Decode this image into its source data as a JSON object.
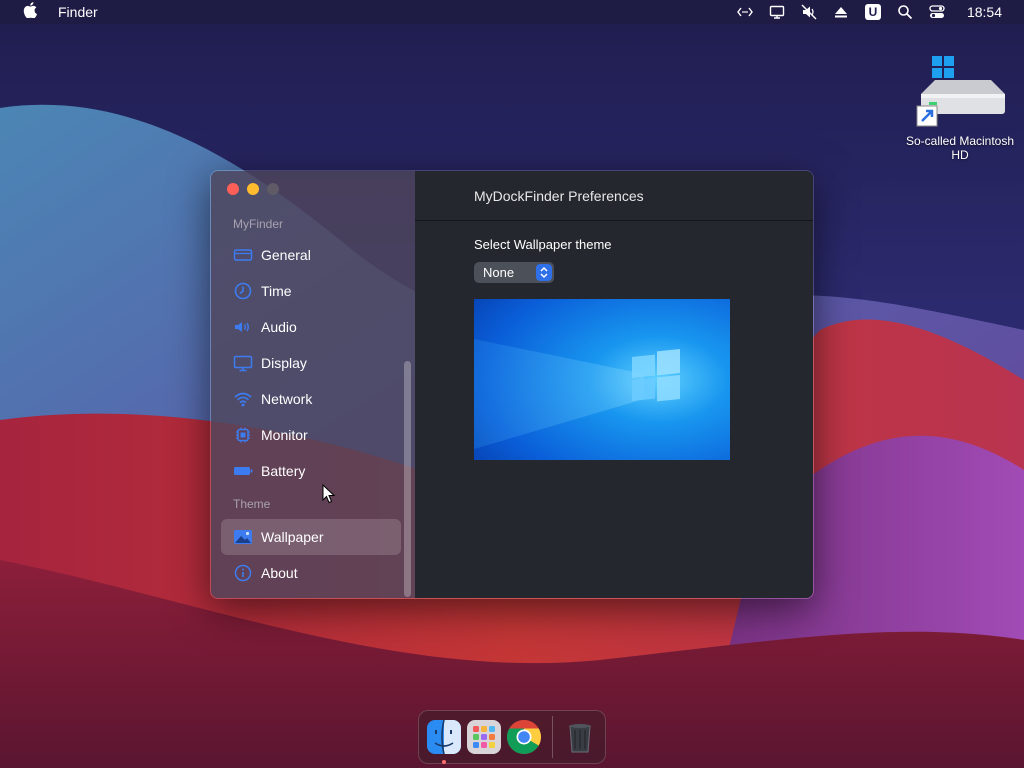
{
  "menubar": {
    "apple_icon": "apple-icon",
    "app_name": "Finder",
    "status_icons": [
      "code-brackets-icon",
      "display-icon",
      "muted-icon",
      "eject-icon",
      "u-badge-icon",
      "search-icon",
      "control-center-icon"
    ],
    "u_badge": "U",
    "clock": "18:54"
  },
  "desktop": {
    "drive_label": "So-called Macintosh HD"
  },
  "window": {
    "title": "MyDockFinder Preferences",
    "sidebar": {
      "section_myfinder": "MyFinder",
      "items_top": [
        {
          "label": "General",
          "icon": "general-icon"
        },
        {
          "label": "Time",
          "icon": "clock-icon"
        },
        {
          "label": "Audio",
          "icon": "speaker-icon"
        },
        {
          "label": "Display",
          "icon": "monitor-icon"
        },
        {
          "label": "Network",
          "icon": "wifi-icon"
        },
        {
          "label": "Monitor",
          "icon": "chip-icon"
        },
        {
          "label": "Battery",
          "icon": "battery-icon"
        }
      ],
      "section_theme": "Theme",
      "items_theme": [
        {
          "label": "Wallpaper",
          "icon": "image-icon",
          "active": true
        },
        {
          "label": "About",
          "icon": "info-icon"
        }
      ]
    },
    "content": {
      "field_label": "Select Wallpaper theme",
      "select_value": "None"
    }
  },
  "dock": {
    "apps": [
      "Finder",
      "Launchpad",
      "Chrome",
      "Trash"
    ]
  },
  "colors": {
    "accent": "#2f6fe8",
    "close": "#fe5f57",
    "minimize": "#febc2e",
    "sidebar_icon": "#3d7cf0"
  }
}
